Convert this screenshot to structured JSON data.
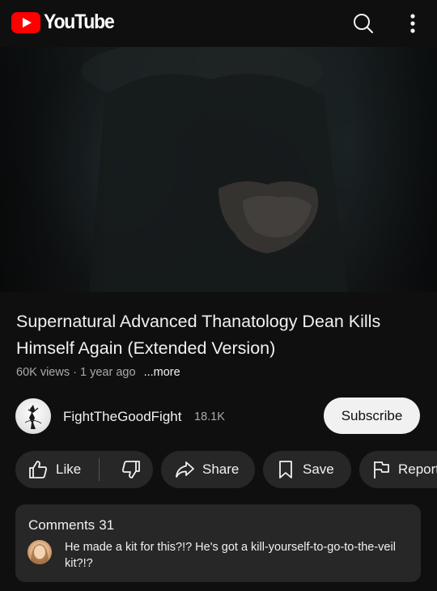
{
  "app": {
    "name": "YouTube",
    "brand_color": "#ff0000"
  },
  "video": {
    "title": "Supernatural Advanced Thanatology Dean Kills Himself Again (Extended Version)",
    "views": "60K views",
    "separator": "·",
    "age": "1 year ago",
    "more_label": "...more"
  },
  "channel": {
    "name": "FightTheGoodFight",
    "subscribers": "18.1K",
    "subscribe_label": "Subscribe"
  },
  "actions": {
    "like_label": "Like",
    "share_label": "Share",
    "save_label": "Save",
    "report_label": "Report"
  },
  "comments": {
    "title": "Comments",
    "count": "31",
    "top_comment": "He made a kit for this?!? He's got a kill-yourself-to-go-to-the-veil kit?!?"
  },
  "icons": {
    "search": "search-icon",
    "menu": "more-vert-icon",
    "like": "thumbs-up-icon",
    "dislike": "thumbs-down-icon",
    "share": "share-arrow-icon",
    "save": "bookmark-icon",
    "report": "flag-icon"
  }
}
